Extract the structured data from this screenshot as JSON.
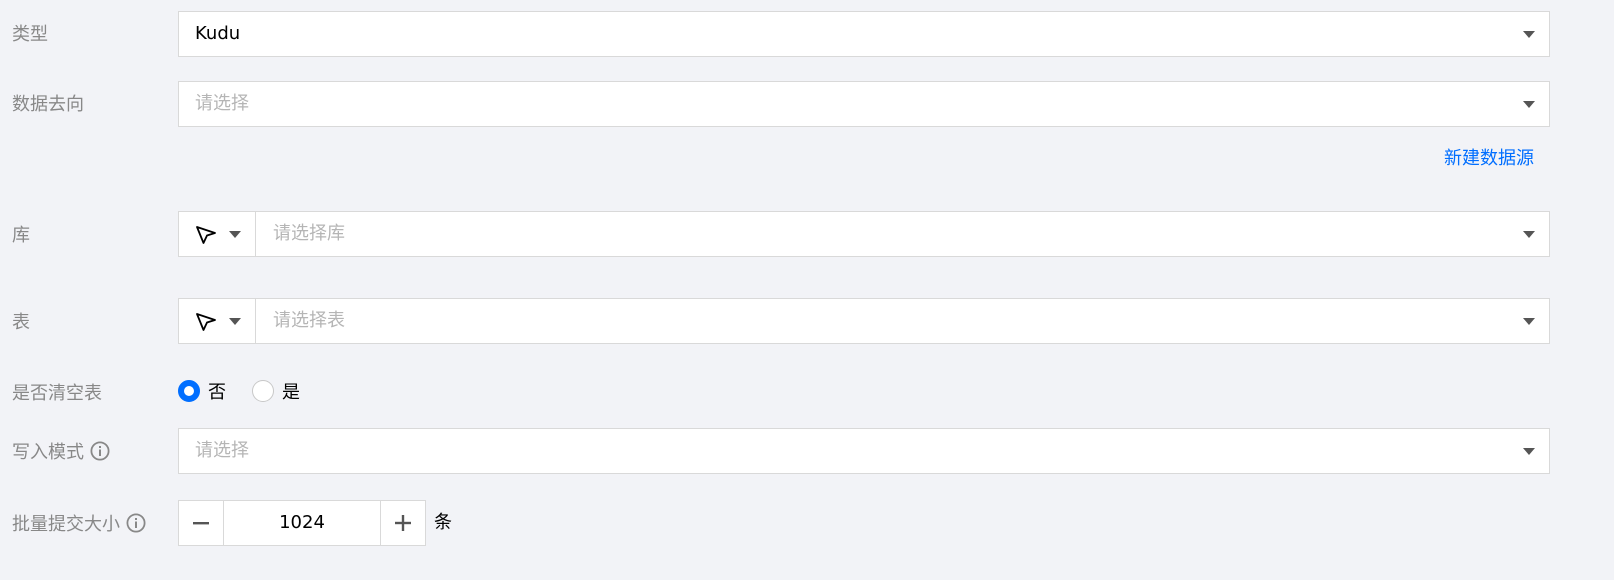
{
  "form": {
    "type": {
      "label": "类型",
      "value": "Kudu"
    },
    "destination": {
      "label": "数据去向",
      "placeholder": "请选择"
    },
    "new_datasource_link": "新建数据源",
    "database": {
      "label": "库",
      "placeholder": "请选择库"
    },
    "table": {
      "label": "表",
      "placeholder": "请选择表"
    },
    "clear_table": {
      "label": "是否清空表",
      "options": [
        {
          "label": "否",
          "checked": true
        },
        {
          "label": "是",
          "checked": false
        }
      ]
    },
    "write_mode": {
      "label": "写入模式",
      "placeholder": "请选择"
    },
    "batch_size": {
      "label": "批量提交大小",
      "value": "1024",
      "unit": "条"
    }
  },
  "icons": {
    "cursor": "cursor-pointer-icon",
    "caret": "chevron-down-icon",
    "info": "info-icon",
    "minus": "minus-icon",
    "plus": "plus-icon"
  },
  "colors": {
    "accent": "#006eff",
    "background": "#f2f3f7",
    "border": "#d9d9d9",
    "placeholder": "#b5b5b5"
  }
}
